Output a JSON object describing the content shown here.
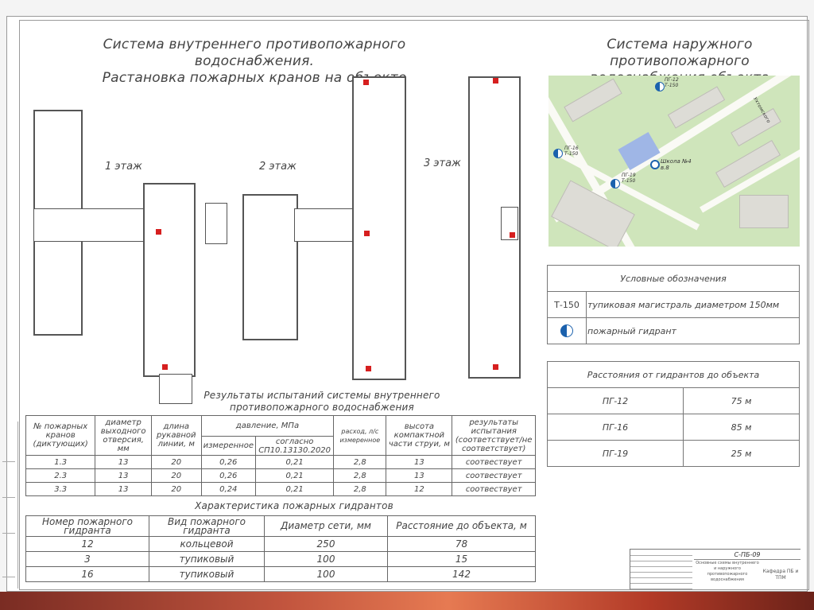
{
  "titles": {
    "internal_line1": "Система внутреннего противопожарного водоснабжения.",
    "internal_line2": "Растановка пожарных кранов на объекте",
    "external_line1": "Система наружного противопожарного",
    "external_line2": "водоснабжения объекта"
  },
  "floors": [
    "1 этаж",
    "2 этаж",
    "3 этаж"
  ],
  "test_results": {
    "title_line1": "Результаты испытаний системы внутреннего",
    "title_line2": "противопожарного водоснабжения",
    "headers": {
      "crane_no": "№ пожарных кранов (диктующих)",
      "diameter": "диаметр выходного отверсия, мм",
      "hose_length": "длина рукавной линии, м",
      "pressure": "давление, МПа",
      "pressure_measured": "измеренное",
      "pressure_norm": "согласно СП10.13130.2020",
      "flow": "расход, л/с измеренное",
      "jet_height": "высота компактной части струи, м",
      "result": "результаты испытания (соответствует/не соответствует)"
    },
    "rows": [
      {
        "no": "1.3",
        "diameter": "13",
        "length": "20",
        "measured": "0,26",
        "norm": "0,21",
        "flow": "2,8",
        "height": "13",
        "result": "соотвествует"
      },
      {
        "no": "2.3",
        "diameter": "13",
        "length": "20",
        "measured": "0,26",
        "norm": "0,21",
        "flow": "2,8",
        "height": "13",
        "result": "соотвествует"
      },
      {
        "no": "3.3",
        "diameter": "13",
        "length": "20",
        "measured": "0,24",
        "norm": "0,21",
        "flow": "2,8",
        "height": "12",
        "result": "соотвествует"
      }
    ]
  },
  "hydrants": {
    "title": "Характеристика пожарных гидрантов",
    "headers": {
      "no": "Номер пожарного гидранта",
      "type": "Вид пожарного гидранта",
      "diameter": "Диаметр сети, мм",
      "distance": "Расстояние до объекта, м"
    },
    "rows": [
      {
        "no": "12",
        "type": "кольцевой",
        "diameter": "250",
        "distance": "78"
      },
      {
        "no": "3",
        "type": "тупиковый",
        "diameter": "100",
        "distance": "15"
      },
      {
        "no": "16",
        "type": "тупиковый",
        "diameter": "100",
        "distance": "142"
      }
    ]
  },
  "map": {
    "school_label": "Школа №4",
    "school_num": "в.8",
    "street": "Ухтомского",
    "hydrant_labels": [
      {
        "id": "ПГ-12",
        "pipe": "Т-150"
      },
      {
        "id": "ПГ-16",
        "pipe": "Т-150"
      },
      {
        "id": "ПГ-19",
        "pipe": "Т-150"
      }
    ]
  },
  "legend": {
    "title": "Условные обозначения",
    "rows": [
      {
        "symbol": "Т-150",
        "text": "тупиковая магистраль диаметром 150мм"
      },
      {
        "symbol": "hydrant-icon",
        "text": "пожарный гидрант"
      }
    ]
  },
  "distances": {
    "title": "Расстояния от гидрантов до объекта",
    "rows": [
      {
        "hydrant": "ПГ-12",
        "distance": "75 м"
      },
      {
        "hydrant": "ПГ-16",
        "distance": "85 м"
      },
      {
        "hydrant": "ПГ-19",
        "distance": "25 м"
      }
    ]
  },
  "stamp": {
    "code": "С-ПБ-09",
    "description": "Основные схемы внутреннего и наружного противопожарного водоснабжения",
    "org": "Кафедра ПБ и ТПМ"
  },
  "colors": {
    "hydrant_marker": "#d61f1f",
    "hydrant_symbol": "#1b61ad",
    "bottom_bar": "#c2553e"
  }
}
